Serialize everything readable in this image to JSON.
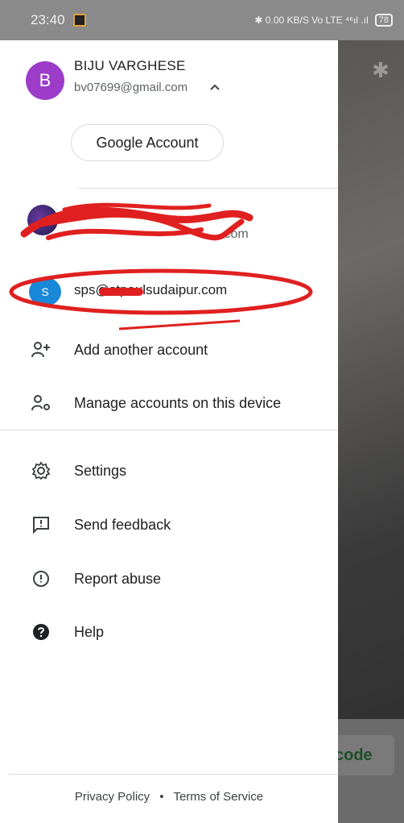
{
  "status_bar": {
    "time": "23:40",
    "indicators": "✱ 0.00 KB/S Vo LTE ⁴⁶ıl .ıl",
    "battery": "78"
  },
  "background_app": {
    "code_button_label": "code"
  },
  "primary_account": {
    "avatar_letter": "B",
    "name": "BIJU VARGHESE",
    "email": "bv07699@gmail.com"
  },
  "google_account_button": "Google Account",
  "other_accounts": [
    {
      "line1": "",
      "line2": ".com"
    },
    {
      "avatar_letter": "S",
      "email": "sps@stpaulsudaipur.com"
    }
  ],
  "menu": [
    {
      "label": "Add another account",
      "icon": "add-person-icon"
    },
    {
      "label": "Manage accounts on this device",
      "icon": "manage-accounts-icon"
    },
    {
      "label": "Settings",
      "icon": "settings-icon"
    },
    {
      "label": "Send feedback",
      "icon": "feedback-icon"
    },
    {
      "label": "Report abuse",
      "icon": "report-abuse-icon"
    },
    {
      "label": "Help",
      "icon": "help-icon"
    }
  ],
  "footer": {
    "privacy": "Privacy Policy",
    "separator": "•",
    "terms": "Terms of Service"
  },
  "colors": {
    "avatar_primary": "#9c3cc9",
    "avatar_secondary": "#1a88d8",
    "scribble": "#e02020"
  }
}
